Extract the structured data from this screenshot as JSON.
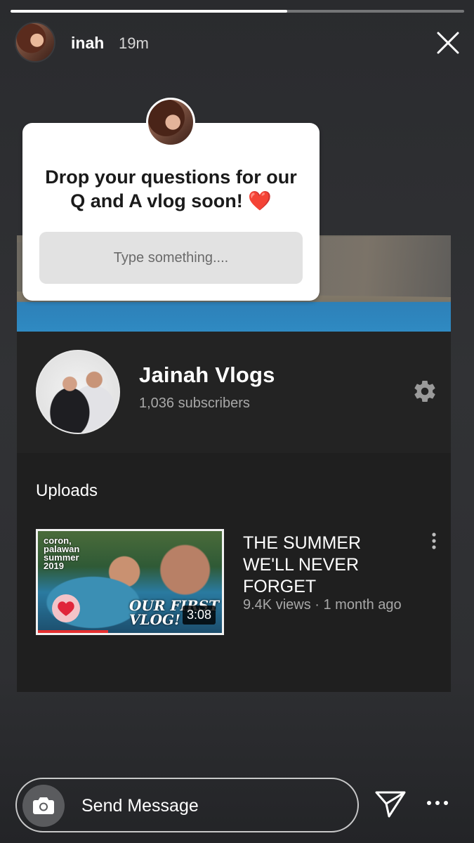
{
  "story": {
    "progress_fraction": 0.61,
    "username": "inah",
    "time_ago": "19m"
  },
  "sticker": {
    "prompt": "Drop your questions for our Q and A vlog soon! ❤️",
    "input_placeholder": "Type something...."
  },
  "channel": {
    "name": "Jainah Vlogs",
    "subscribers": "1,036 subscribers",
    "uploads_label": "Uploads"
  },
  "video": {
    "thumb_caption": "coron, palawan summer 2019",
    "thumb_overlay": "OUR FIRST VLOG!",
    "duration": "3:08",
    "title": "THE SUMMER WE'LL NEVER FORGET",
    "meta": "9.4K views · 1 month ago"
  },
  "footer": {
    "send_message_label": "Send Message"
  },
  "colors": {
    "accent_red": "#e53030",
    "heart": "#e0253a"
  }
}
